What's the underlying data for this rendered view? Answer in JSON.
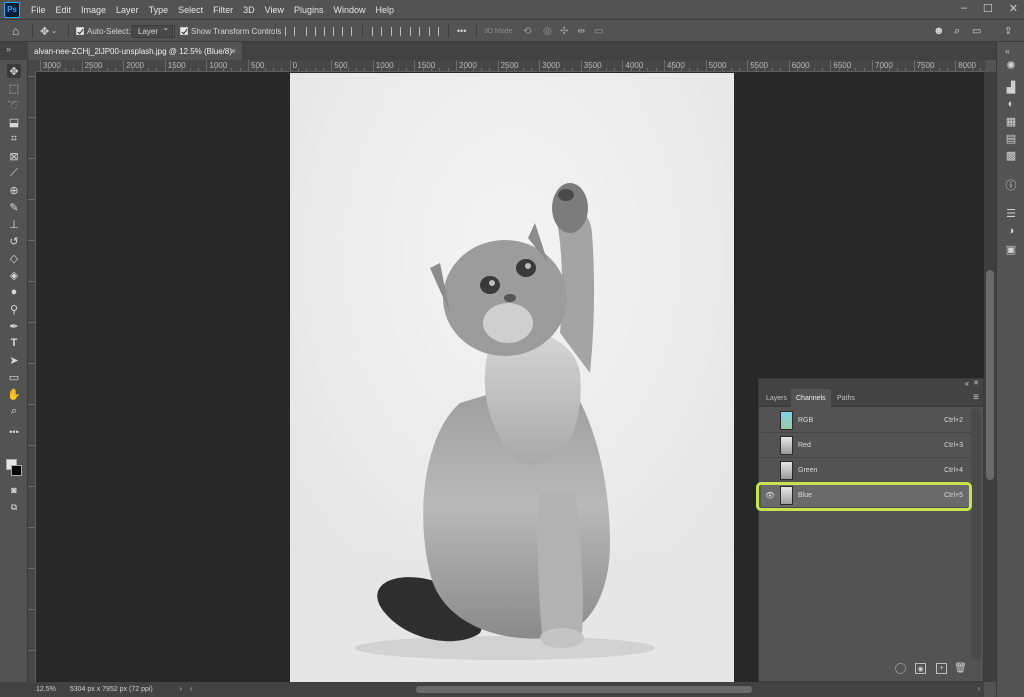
{
  "app": {
    "logo": "Ps"
  },
  "menu": [
    "File",
    "Edit",
    "Image",
    "Layer",
    "Type",
    "Select",
    "Filter",
    "3D",
    "View",
    "Plugins",
    "Window",
    "Help"
  ],
  "window_controls": {
    "minimize": "–",
    "maximize": "☐",
    "close": "✕"
  },
  "options": {
    "auto_select_label": "Auto-Select:",
    "auto_select_target": "Layer",
    "show_transform_label": "Show Transform Controls",
    "more": "•••",
    "mode_3d": "3D Mode:"
  },
  "document": {
    "tab_title": "alvan-nee-ZCHj_2lJP00-unsplash.jpg @ 12.5% (Blue/8)",
    "tab_close": "×"
  },
  "ruler": {
    "h_labels": [
      "3000",
      "2500",
      "2000",
      "1500",
      "1000",
      "500",
      "0",
      "500",
      "1000",
      "1500",
      "2000",
      "2500",
      "3000",
      "3500",
      "4000",
      "4500",
      "5000",
      "5500",
      "6000",
      "6500",
      "7000",
      "7500",
      "8000"
    ]
  },
  "status": {
    "zoom": "12.5%",
    "dimensions": "5304 px x 7952 px (72 ppi)",
    "arrow": "›"
  },
  "panel": {
    "tabs": [
      "Layers",
      "Channels",
      "Paths"
    ],
    "active_tab": "Channels",
    "channels": [
      {
        "name": "RGB",
        "shortcut": "Ctrl+2",
        "visible": false,
        "selected": false
      },
      {
        "name": "Red",
        "shortcut": "Ctrl+3",
        "visible": false,
        "selected": false
      },
      {
        "name": "Green",
        "shortcut": "Ctrl+4",
        "visible": false,
        "selected": false
      },
      {
        "name": "Blue",
        "shortcut": "Ctrl+5",
        "visible": true,
        "selected": true
      }
    ],
    "collapse_icon": "«",
    "close_icon": "✕",
    "menu_icon": "≡"
  },
  "colors": {
    "highlight": "#c7e34f",
    "pasteboard": "#282828",
    "ui_gray": "#535353",
    "ps_blue": "#31a8ff"
  }
}
